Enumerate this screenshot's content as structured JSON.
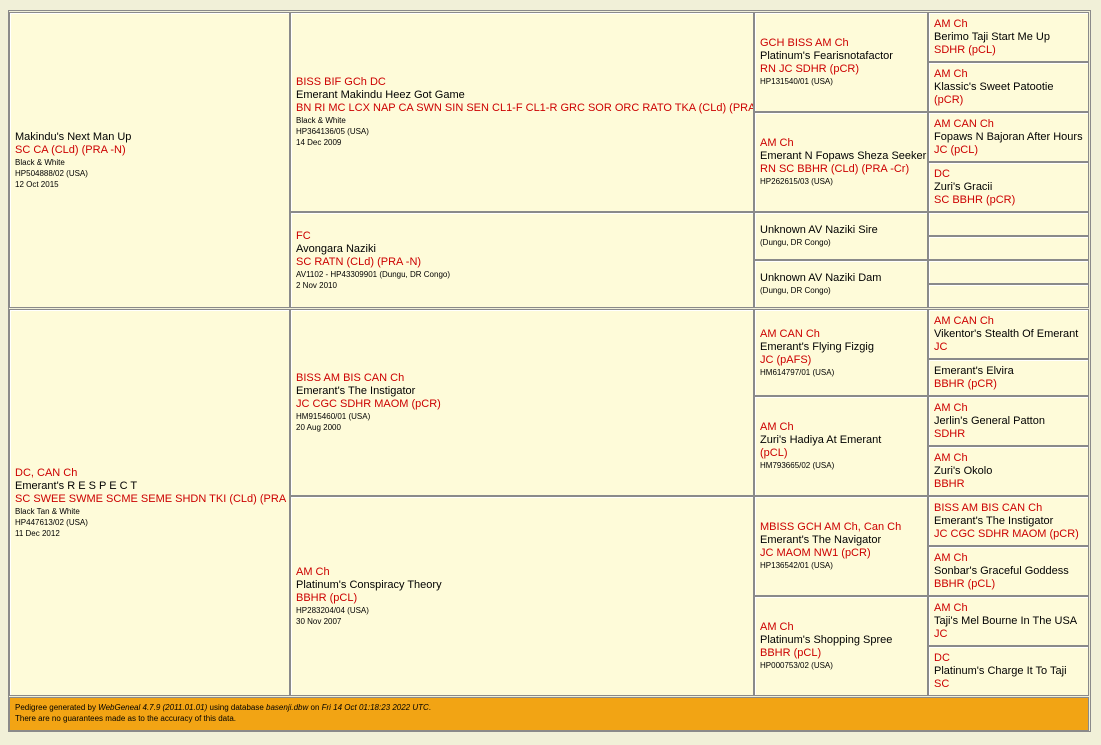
{
  "dogs": {
    "self1": {
      "titles": "",
      "name": "Makindu's Next Man Up",
      "suffix": "SC CA (CLd) (PRA -N)",
      "color": "Black & White",
      "reg": "HP504888/02 (USA)",
      "dob": "12 Oct 2015"
    },
    "self2": {
      "titles": "DC, CAN Ch",
      "name": "Emerant's R E S P E C T",
      "suffix": "SC SWEE SWME SCME SEME SHDN TKI (CLd) (PRA -Cr)",
      "color": "Black Tan & White",
      "reg": "HP447613/02 (USA)",
      "dob": "11 Dec 2012"
    },
    "s": {
      "titles": "BISS BIF GCh DC",
      "name": "Emerant Makindu Heez Got Game",
      "suffix": "BN RI MC LCX NAP CA SWN SIN SEN CL1-F CL1-R GRC SOR ORC RATO TKA (CLd) (PRA -Cr)",
      "color": "Black & White",
      "reg": "HP364136/05 (USA)",
      "dob": "14 Dec 2009"
    },
    "d": {
      "titles": "FC",
      "name": "Avongara Naziki",
      "suffix": "SC RATN (CLd) (PRA -N)",
      "color": "",
      "reg": "AV1102 - HP43309901 (Dungu, DR Congo)",
      "dob": "2 Nov 2010"
    },
    "s2": {
      "titles": "BISS AM BIS CAN Ch",
      "name": "Emerant's The Instigator",
      "suffix": "JC CGC SDHR MAOM (pCR)",
      "color": "",
      "reg": "HM915460/01 (USA)",
      "dob": "20 Aug 2000"
    },
    "d2": {
      "titles": "AM Ch",
      "name": "Platinum's Conspiracy Theory",
      "suffix": "BBHR (pCL)",
      "color": "",
      "reg": "HP283204/04 (USA)",
      "dob": "30 Nov 2007"
    },
    "ss": {
      "titles": "GCH BISS AM Ch",
      "name": "Platinum's Fearisnotafactor",
      "suffix": "RN JC SDHR (pCR)",
      "reg": "HP131540/01 (USA)"
    },
    "sd": {
      "titles": "AM Ch",
      "name": "Emerant N Fopaws Sheza Seeker",
      "suffix": "RN SC BBHR (CLd) (PRA -Cr)",
      "reg": "HP262615/03 (USA)"
    },
    "ds": {
      "titles": "",
      "name": "Unknown AV Naziki Sire",
      "suffix": "",
      "reg": "(Dungu, DR Congo)"
    },
    "dd": {
      "titles": "",
      "name": "Unknown AV Naziki Dam",
      "suffix": "",
      "reg": "(Dungu, DR Congo)"
    },
    "s2s": {
      "titles": "AM CAN Ch",
      "name": "Emerant's Flying Fizgig",
      "suffix": "JC (pAFS)",
      "reg": "HM614797/01 (USA)"
    },
    "s2d": {
      "titles": "AM Ch",
      "name": "Zuri's Hadiya At Emerant",
      "suffix": "(pCL)",
      "reg": "HM793665/02 (USA)"
    },
    "d2s": {
      "titles": "MBISS GCH AM Ch, Can Ch",
      "name": "Emerant's The Navigator",
      "suffix": "JC MAOM NW1 (pCR)",
      "reg": "HP136542/01 (USA)"
    },
    "d2d": {
      "titles": "AM Ch",
      "name": "Platinum's Shopping Spree",
      "suffix": "BBHR (pCL)",
      "reg": "HP000753/02 (USA)"
    },
    "g1": {
      "titles": "AM Ch",
      "name": "Berimo Taji Start Me Up",
      "suffix": "SDHR (pCL)"
    },
    "g2": {
      "titles": "AM Ch",
      "name": "Klassic's Sweet Patootie",
      "suffix": "(pCR)"
    },
    "g3": {
      "titles": "AM CAN Ch",
      "name": "Fopaws N Bajoran After Hours",
      "suffix": "JC (pCL)"
    },
    "g4": {
      "titles": "DC",
      "name": "Zuri's Gracii",
      "suffix": "SC BBHR (pCR)"
    },
    "g9": {
      "titles": "AM CAN Ch",
      "name": "Vikentor's Stealth Of Emerant",
      "suffix": "JC"
    },
    "g10": {
      "titles": "",
      "name": "Emerant's Elvira",
      "suffix": "BBHR (pCR)"
    },
    "g11": {
      "titles": "AM Ch",
      "name": "Jerlin's General Patton",
      "suffix": "SDHR"
    },
    "g12": {
      "titles": "AM Ch",
      "name": "Zuri's Okolo",
      "suffix": "BBHR"
    },
    "g13": {
      "titles": "BISS AM BIS CAN Ch",
      "name": "Emerant's The Instigator",
      "suffix": "JC CGC SDHR MAOM (pCR)"
    },
    "g14": {
      "titles": "AM Ch",
      "name": "Sonbar's Graceful Goddess",
      "suffix": "BBHR (pCL)"
    },
    "g15": {
      "titles": "AM Ch",
      "name": "Taji's Mel Bourne In The USA",
      "suffix": "JC"
    },
    "g16": {
      "titles": "DC",
      "name": "Platinum's Charge It To Taji",
      "suffix": "SC"
    }
  },
  "footer": {
    "p1": "Pedigree generated by ",
    "app": "WebGeneal 4.7.9 (2011.01.01)",
    "p2": " using database ",
    "db": "basenji.dbw",
    "p3": " on ",
    "date": "Fri 14 Oct 01:18:23 2022 UTC",
    "p4": ".",
    "disclaimer": "There are no guarantees made as to the accuracy of this data."
  },
  "colors": {
    "title": "#cc0000",
    "cell_bg": "#fefbd9",
    "footer_bg": "#f2a414",
    "page_bg": "#f1f0d8"
  }
}
